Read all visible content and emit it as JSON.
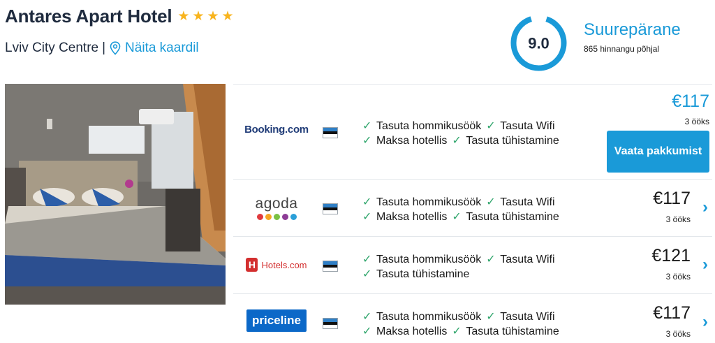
{
  "hotel": {
    "name": "Antares Apart Hotel",
    "star_count": 4,
    "location": "Lviv City Centre",
    "location_separator": "|",
    "map_link": "Näita kaardil"
  },
  "rating": {
    "score": "9.0",
    "label": "Suurepärane",
    "count_text": "865 hinnangu põhjal",
    "ring_color": "#1a9ad8"
  },
  "offers": [
    {
      "provider": "Booking.com",
      "flag": "estonian-flag",
      "features_line1": [
        "Tasuta hommikusöök",
        "Tasuta Wifi"
      ],
      "features_line2": [
        "Maksa hotellis",
        "Tasuta tühistamine"
      ],
      "price": "€117",
      "nights": "3 ööks",
      "button": "Vaata pakkumist"
    },
    {
      "provider": "agoda",
      "flag": "estonian-flag",
      "features_line1": [
        "Tasuta hommikusöök",
        "Tasuta Wifi"
      ],
      "features_line2": [
        "Maksa hotellis",
        "Tasuta tühistamine"
      ],
      "price": "€117",
      "nights": "3 ööks"
    },
    {
      "provider": "Hotels.com",
      "flag": "estonian-flag",
      "features_line1": [
        "Tasuta hommikusöök",
        "Tasuta Wifi"
      ],
      "features_line2": [
        "Tasuta tühistamine"
      ],
      "price": "€121",
      "nights": "3 ööks"
    },
    {
      "provider": "priceline",
      "flag": "estonian-flag",
      "features_line1": [
        "Tasuta hommikusöök",
        "Tasuta Wifi"
      ],
      "features_line2": [
        "Maksa hotellis",
        "Tasuta tühistamine"
      ],
      "price": "€117",
      "nights": "3 ööks"
    }
  ],
  "colors": {
    "accent": "#1a9ad8",
    "check": "#2ea56b",
    "star": "#f8b41e"
  }
}
